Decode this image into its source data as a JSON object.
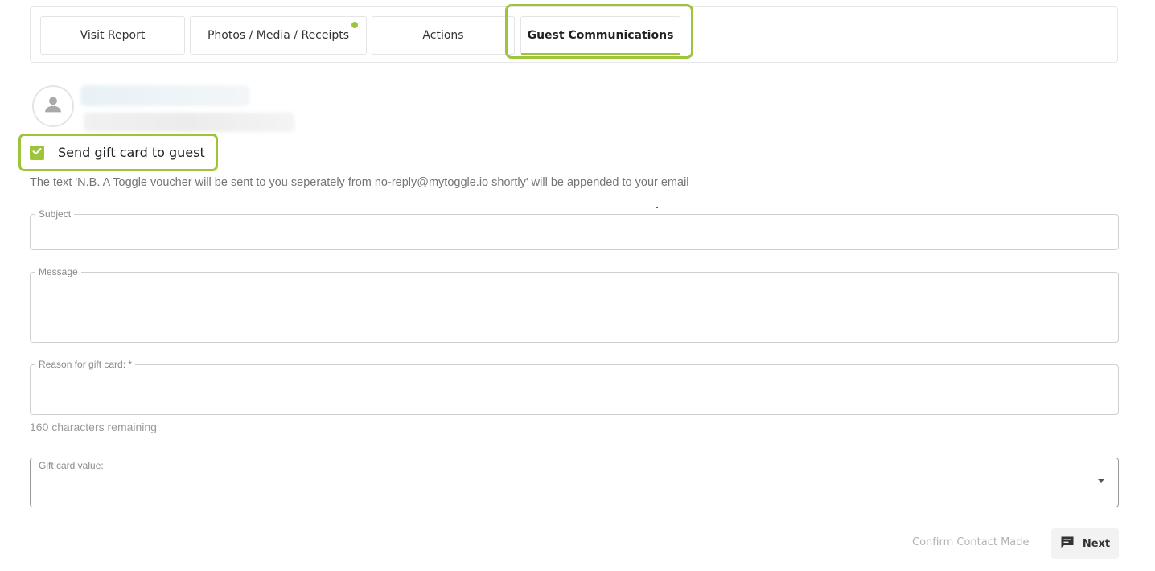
{
  "tabs": [
    {
      "label": "Visit Report"
    },
    {
      "label": "Photos / Media / Receipts"
    },
    {
      "label": "Actions"
    },
    {
      "label": "Guest Communications"
    }
  ],
  "active_tab": "Guest Communications",
  "guest": {
    "avatar_icon": "person-icon"
  },
  "gift_card": {
    "checkbox_label": "Send gift card to guest",
    "checked": true,
    "note": "The text 'N.B. A Toggle voucher will be sent to you seperately from no-reply@mytoggle.io shortly' will be appended to your email"
  },
  "form": {
    "subject_label": "Subject",
    "subject_value": "",
    "message_label": "Message",
    "message_value": "",
    "reason_label": "Reason for gift card: *",
    "reason_value": "",
    "chars_remaining": "160 characters remaining",
    "gift_value_label": "Gift card value:",
    "gift_value_selected": ""
  },
  "footer": {
    "confirm_label": "Confirm Contact Made",
    "next_label": "Next"
  },
  "colors": {
    "accent": "#9dc43a"
  }
}
